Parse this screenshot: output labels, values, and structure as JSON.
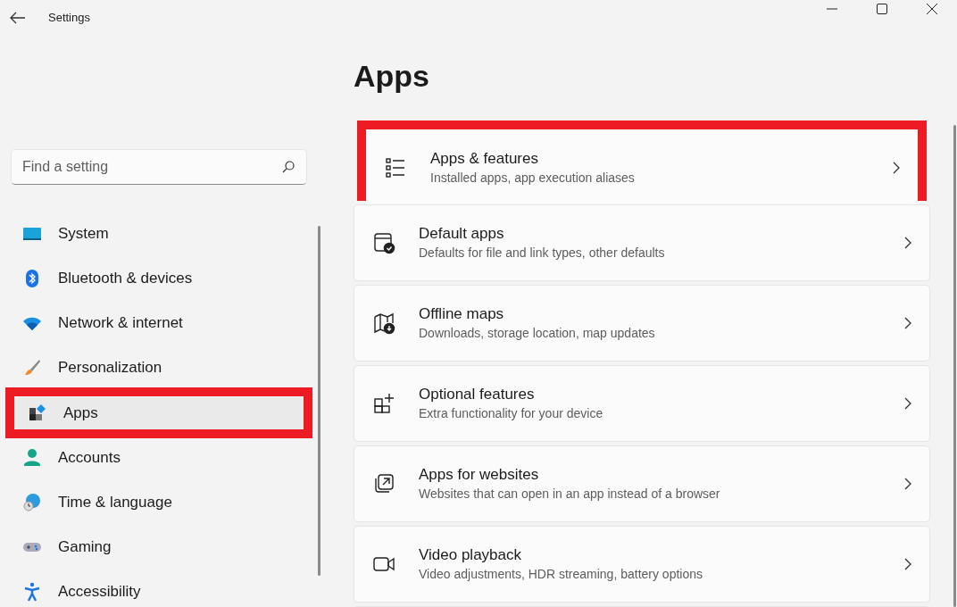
{
  "window": {
    "title": "Settings"
  },
  "search": {
    "placeholder": "Find a setting"
  },
  "sidebar": {
    "items": [
      {
        "label": "System",
        "kind": "system",
        "selected": false,
        "highlighted": false
      },
      {
        "label": "Bluetooth & devices",
        "kind": "bluetooth",
        "selected": false,
        "highlighted": false
      },
      {
        "label": "Network & internet",
        "kind": "wifi",
        "selected": false,
        "highlighted": false
      },
      {
        "label": "Personalization",
        "kind": "brush",
        "selected": false,
        "highlighted": false
      },
      {
        "label": "Apps",
        "kind": "apps",
        "selected": true,
        "highlighted": true
      },
      {
        "label": "Accounts",
        "kind": "person",
        "selected": false,
        "highlighted": false
      },
      {
        "label": "Time & language",
        "kind": "globe",
        "selected": false,
        "highlighted": false
      },
      {
        "label": "Gaming",
        "kind": "gamepad",
        "selected": false,
        "highlighted": false
      },
      {
        "label": "Accessibility",
        "kind": "accessibility",
        "selected": false,
        "highlighted": false
      }
    ]
  },
  "page": {
    "title": "Apps",
    "cards": [
      {
        "title": "Apps & features",
        "subtitle": "Installed apps, app execution aliases",
        "kind": "list",
        "highlighted": true
      },
      {
        "title": "Default apps",
        "subtitle": "Defaults for file and link types, other defaults",
        "kind": "default",
        "highlighted": false
      },
      {
        "title": "Offline maps",
        "subtitle": "Downloads, storage location, map updates",
        "kind": "map",
        "highlighted": false
      },
      {
        "title": "Optional features",
        "subtitle": "Extra functionality for your device",
        "kind": "grid",
        "highlighted": false
      },
      {
        "title": "Apps for websites",
        "subtitle": "Websites that can open in an app instead of a browser",
        "kind": "openapp",
        "highlighted": false
      },
      {
        "title": "Video playback",
        "subtitle": "Video adjustments, HDR streaming, battery options",
        "kind": "video",
        "highlighted": false
      }
    ]
  }
}
